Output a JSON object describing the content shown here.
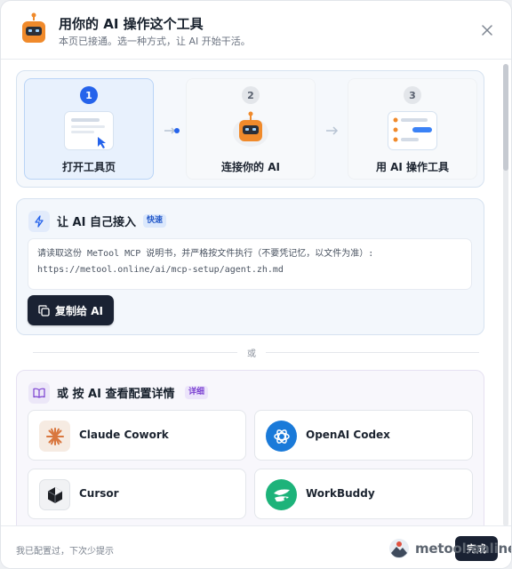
{
  "header": {
    "title": "用你的 AI 操作这个工具",
    "subtitle": "本页已接通。选一种方式，让 AI 开始干活。",
    "close_icon": "close-icon"
  },
  "steps": [
    {
      "number": "1",
      "label": "打开工具页",
      "state": "active"
    },
    {
      "number": "2",
      "label": "连接你的 AI",
      "state": "inactive"
    },
    {
      "number": "3",
      "label": "用 AI 操作工具",
      "state": "inactive"
    }
  ],
  "quick": {
    "title": "让 AI 自己接入",
    "badge": "快速",
    "instruction_line1": "请读取这份 MeTool MCP 说明书，并严格按文件执行（不要凭记忆，以文件为准）:",
    "instruction_line2": "https://metool.online/ai/mcp-setup/agent.zh.md",
    "copy_button": "复制给 AI"
  },
  "divider_text": "或",
  "detail": {
    "title": "或 按 AI 查看配置详情",
    "badge": "详细",
    "tools": [
      {
        "name": "Claude Cowork",
        "icon": "claude-icon"
      },
      {
        "name": "OpenAI Codex",
        "icon": "openai-icon"
      },
      {
        "name": "Cursor",
        "icon": "cursor-icon"
      },
      {
        "name": "WorkBuddy",
        "icon": "workbuddy-icon"
      }
    ]
  },
  "footer": {
    "hint": "我已配置过，下次少提示",
    "done_button": "完成",
    "watermark": "metool.online"
  },
  "colors": {
    "accent": "#2563eb",
    "dark_button": "#1a2233",
    "robot_orange": "#f08a2b"
  }
}
